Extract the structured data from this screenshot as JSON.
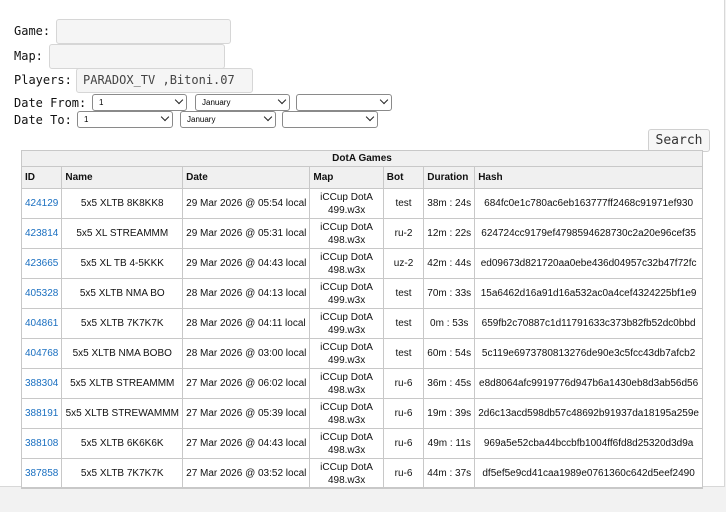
{
  "form": {
    "game_label": "Game:",
    "game_value": "",
    "map_label": "Map:",
    "map_value": "",
    "players_label": "Players:",
    "players_value": "PARADOX_TV ,Bitoni.07",
    "date_from_label": "Date From:",
    "date_from_day": "1",
    "date_from_month": "January",
    "date_from_year": "",
    "date_to_label": "Date To:",
    "date_to_day": "1",
    "date_to_month": "January",
    "date_to_year": "",
    "search_label": "Search"
  },
  "table": {
    "caption": "DotA Games",
    "headers": [
      "ID",
      "Name",
      "Date",
      "Map",
      "Bot",
      "Duration",
      "Hash"
    ],
    "rows": [
      {
        "id": "424129",
        "name": "5x5 XLTB 8K8KK8",
        "date": "29 Mar 2026 @ 05:54 local",
        "map1": "iCCup DotA",
        "map2": "499.w3x",
        "bot": "test",
        "duration": "38m : 24s",
        "hash": "684fc0e1c780ac6eb163777ff2468c91971ef930"
      },
      {
        "id": "423814",
        "name": "5x5 XL STREAMMM",
        "date": "29 Mar 2026 @ 05:31 local",
        "map1": "iCCup DotA",
        "map2": "498.w3x",
        "bot": "ru-2",
        "duration": "12m : 22s",
        "hash": "624724cc9179ef4798594628730c2a20e96cef35"
      },
      {
        "id": "423665",
        "name": "5x5 XL TB 4-5KKK",
        "date": "29 Mar 2026 @ 04:43 local",
        "map1": "iCCup DotA",
        "map2": "498.w3x",
        "bot": "uz-2",
        "duration": "42m : 44s",
        "hash": "ed09673d821720aa0ebe436d04957c32b47f72fc"
      },
      {
        "id": "405328",
        "name": "5x5 XLTB NMA BO",
        "date": "28 Mar 2026 @ 04:13 local",
        "map1": "iCCup DotA",
        "map2": "499.w3x",
        "bot": "test",
        "duration": "70m : 33s",
        "hash": "15a6462d16a91d16a532ac0a4cef4324225bf1e9"
      },
      {
        "id": "404861",
        "name": "5x5 XLTB 7K7K7K",
        "date": "28 Mar 2026 @ 04:11 local",
        "map1": "iCCup DotA",
        "map2": "499.w3x",
        "bot": "test",
        "duration": "0m : 53s",
        "hash": "659fb2c70887c1d11791633c373b82fb52dc0bbd"
      },
      {
        "id": "404768",
        "name": "5x5 XLTB NMA BOBO",
        "date": "28 Mar 2026 @ 03:00 local",
        "map1": "iCCup DotA",
        "map2": "499.w3x",
        "bot": "test",
        "duration": "60m : 54s",
        "hash": "5c119e6973780813276de90e3c5fcc43db7afcb2"
      },
      {
        "id": "388304",
        "name": "5x5 XLTB STREAMMM",
        "date": "27 Mar 2026 @ 06:02 local",
        "map1": "iCCup DotA",
        "map2": "498.w3x",
        "bot": "ru-6",
        "duration": "36m : 45s",
        "hash": "e8d8064afc9919776d947b6a1430eb8d3ab56d56"
      },
      {
        "id": "388191",
        "name": "5x5 XLTB STREWAMMM",
        "date": "27 Mar 2026 @ 05:39 local",
        "map1": "iCCup DotA",
        "map2": "498.w3x",
        "bot": "ru-6",
        "duration": "19m : 39s",
        "hash": "2d6c13acd598db57c48692b91937da18195a259e"
      },
      {
        "id": "388108",
        "name": "5x5 XLTB 6K6K6K",
        "date": "27 Mar 2026 @ 04:43 local",
        "map1": "iCCup DotA",
        "map2": "498.w3x",
        "bot": "ru-6",
        "duration": "49m : 11s",
        "hash": "969a5e52cba44bccbfb1004ff6fd8d25320d3d9a"
      },
      {
        "id": "387858",
        "name": "5x5 XLTB 7K7K7K",
        "date": "27 Mar 2026 @ 03:52 local",
        "map1": "iCCup DotA",
        "map2": "498.w3x",
        "bot": "ru-6",
        "duration": "44m : 37s",
        "hash": "df5ef5e9cd41caa1989e0761360c642d5eef2490"
      }
    ]
  }
}
